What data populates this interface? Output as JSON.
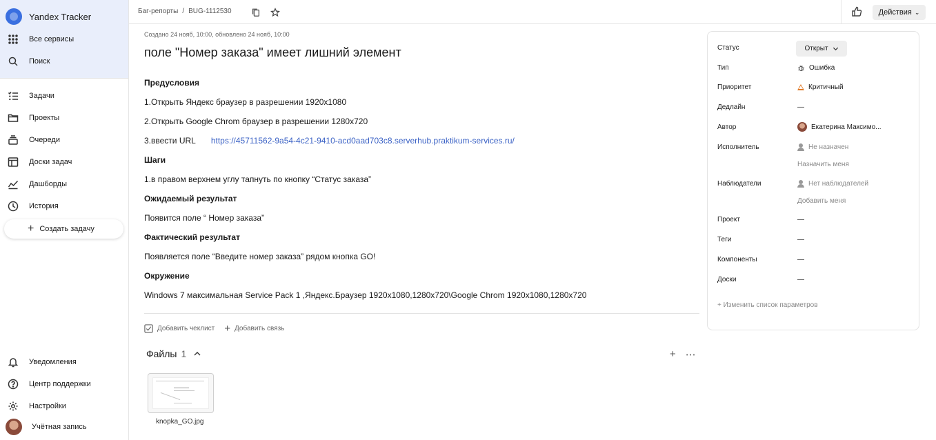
{
  "sidebar": {
    "brand": "Yandex Tracker",
    "top_items": [
      {
        "label": "Все сервисы",
        "icon": "grid-icon"
      },
      {
        "label": "Поиск",
        "icon": "search-icon"
      }
    ],
    "items": [
      {
        "label": "Задачи",
        "icon": "tasks-icon"
      },
      {
        "label": "Проекты",
        "icon": "folder-icon"
      },
      {
        "label": "Очереди",
        "icon": "queue-icon"
      },
      {
        "label": "Доски задач",
        "icon": "board-icon"
      },
      {
        "label": "Дашборды",
        "icon": "chart-icon"
      },
      {
        "label": "История",
        "icon": "clock-icon"
      }
    ],
    "create_label": "Создать задачу",
    "bottom_items": [
      {
        "label": "Уведомления",
        "icon": "bell-icon"
      },
      {
        "label": "Центр поддержки",
        "icon": "help-icon"
      },
      {
        "label": "Настройки",
        "icon": "gear-icon"
      },
      {
        "label": "Учётная запись",
        "icon": "avatar"
      }
    ]
  },
  "topbar": {
    "breadcrumb": [
      "Баг-репорты",
      "BUG-1112530"
    ],
    "breadcrumb_sep": "/",
    "actions_label": "Действия"
  },
  "issue": {
    "meta": "Создано 24 нояб, 10:00, обновлено 24 нояб, 10:00",
    "title": "поле \"Номер заказа\" имеет лишний элемент",
    "sections": {
      "pre_h": "Предусловия",
      "pre_1": "1.Открыть Яндекс браузер в разрешении 1920x1080",
      "pre_2": "2.Открыть Google Chrom браузер в разрешении 1280x720",
      "pre_3": "3.ввести URL",
      "pre_3_link": "https://45711562-9a54-4c21-9410-acd0aad703c8.serverhub.praktikum-services.ru/",
      "steps_h": "Шаги",
      "steps_1": "1.в правом верхнем углу тапнуть по кнопку “Статус заказа”",
      "expected_h": "Ожидаемый результат",
      "expected_1": "Появится поле “ Номер заказа”",
      "actual_h": "Фактический результат",
      "actual_1": "Появляется поле “Введите номер заказа” рядом кнопка GO!",
      "env_h": "Окружение",
      "env_1": "Windows 7 максимальная Service Pack 1 ,Яндекс.Браузер 1920x1080,1280x720\\Google Chrom 1920x1080,1280x720"
    },
    "add_checklist": "Добавить чеклист",
    "add_link": "Добавить связь",
    "files_label": "Файлы",
    "files_count": "1",
    "file_name": "knopka_GO.jpg"
  },
  "panel": {
    "status_label": "Статус",
    "status_value": "Открыт",
    "type_label": "Тип",
    "type_value": "Ошибка",
    "priority_label": "Приоритет",
    "priority_value": "Критичный",
    "deadline_label": "Дедлайн",
    "deadline_value": "—",
    "author_label": "Автор",
    "author_value": "Екатерина Максимо...",
    "assignee_label": "Исполнитель",
    "assignee_value": "Не назначен",
    "assign_me": "Назначить меня",
    "followers_label": "Наблюдатели",
    "followers_value": "Нет наблюдателей",
    "add_me": "Добавить меня",
    "project_label": "Проект",
    "project_value": "—",
    "tags_label": "Теги",
    "tags_value": "—",
    "components_label": "Компоненты",
    "components_value": "—",
    "boards_label": "Доски",
    "boards_value": "—",
    "edit_params": "+ Изменить список параметров"
  },
  "colors": {
    "link": "#3b62c5",
    "sidebar_top_bg": "#e9eefb",
    "priority_critical": "#e07b2a",
    "brand_logo": "#3a6fe0"
  }
}
